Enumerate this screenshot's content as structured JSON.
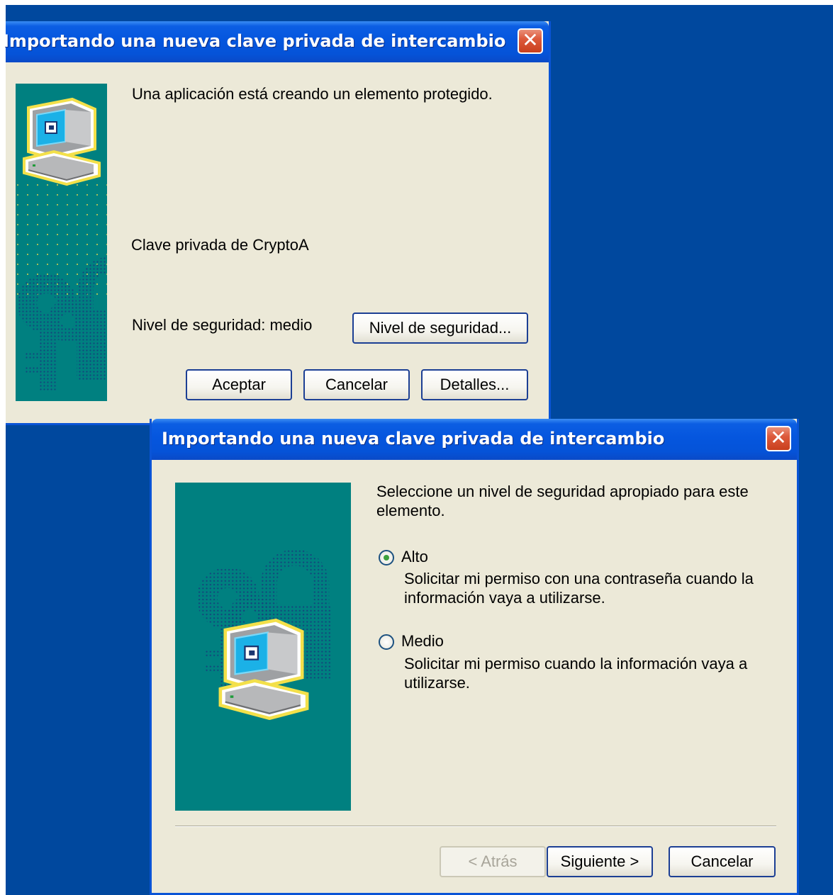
{
  "dialog1": {
    "title": "Importando una nueva clave privada de intercambio",
    "message": "Una aplicación está creando un elemento protegido.",
    "item_name": "Clave privada de CryptoA",
    "security_level_text": "Nivel de seguridad: medio",
    "security_level_button": "Nivel de seguridad...",
    "ok_button": "Aceptar",
    "cancel_button": "Cancelar",
    "details_button": "Detalles..."
  },
  "dialog2": {
    "title": "Importando una nueva clave privada de intercambio",
    "instruction_line1": "Seleccione un nivel de seguridad apropiado para este",
    "instruction_line2": "elemento.",
    "options": [
      {
        "label": "Alto",
        "desc_line1": "Solicitar mi permiso con una contraseña cuando la",
        "desc_line2": "información vaya a utilizarse.",
        "selected": true
      },
      {
        "label": "Medio",
        "desc_line1": "Solicitar mi permiso cuando la información vaya a",
        "desc_line2": "utilizarse.",
        "selected": false
      }
    ],
    "back_button": "< Atrás",
    "next_button": "Siguiente >",
    "cancel_button": "Cancelar"
  },
  "icons": [
    "close-icon",
    "computer-icon",
    "keys-icon",
    "padlock-icon"
  ],
  "colors": {
    "desktop": "#00489e",
    "titlebar": "#0556de",
    "dialog_body": "#ece9d8",
    "art_panel": "#008080",
    "close_button": "#dd5a3c",
    "radio_selected": "#3da13d"
  }
}
